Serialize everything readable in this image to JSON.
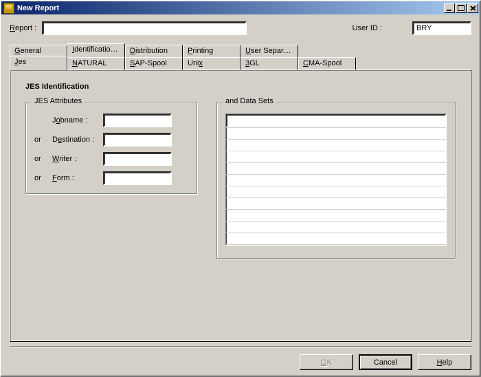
{
  "window": {
    "title": "New Report"
  },
  "header": {
    "report_label": "Report :",
    "report_value": "",
    "userid_label": "User ID :",
    "userid_value": "BRY"
  },
  "tabs_row1": [
    {
      "label": "General",
      "accel": "G"
    },
    {
      "label": "Identification...",
      "accel": "I",
      "active": true
    },
    {
      "label": "Distribution",
      "accel": "D"
    },
    {
      "label": "Printing",
      "accel": "P"
    },
    {
      "label": "User Separation",
      "accel": "U"
    }
  ],
  "tabs_row2": [
    {
      "label": "Jes",
      "accel": "J",
      "active": true
    },
    {
      "label": "NATURAL",
      "accel": "N"
    },
    {
      "label": "SAP-Spool",
      "accel": "S"
    },
    {
      "label": "Unix",
      "accel": "x"
    },
    {
      "label": "3GL",
      "accel": "3"
    },
    {
      "label": "CMA-Spool",
      "accel": "C"
    }
  ],
  "section_title": "JES Identification",
  "attrs": {
    "legend": "JES Attributes",
    "rows": [
      {
        "or": "",
        "label": "Jobname :",
        "accel": "o",
        "value": ""
      },
      {
        "or": "or",
        "label": "Destination :",
        "accel": "e",
        "value": ""
      },
      {
        "or": "or",
        "label": "Writer :",
        "accel": "W",
        "value": ""
      },
      {
        "or": "or",
        "label": "Form :",
        "accel": "F",
        "value": ""
      }
    ]
  },
  "datasets": {
    "legend": "and  Data Sets",
    "rows": [
      "",
      "",
      "",
      "",
      "",
      "",
      "",
      "",
      "",
      "",
      ""
    ]
  },
  "buttons": {
    "ok": "OK",
    "cancel": "Cancel",
    "help": "Help"
  }
}
